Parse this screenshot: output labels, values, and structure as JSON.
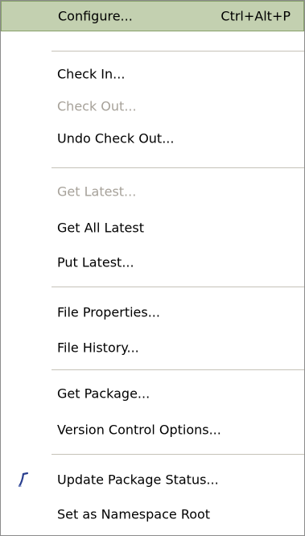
{
  "menu": {
    "items": [
      {
        "label": "Configure...",
        "shortcut": "Ctrl+Alt+P",
        "state": "highlighted"
      },
      {
        "label": "Check In...",
        "state": "enabled"
      },
      {
        "label": "Check Out...",
        "state": "disabled"
      },
      {
        "label": "Undo Check Out...",
        "state": "enabled"
      },
      {
        "label": "Get Latest...",
        "state": "disabled"
      },
      {
        "label": "Get All Latest",
        "state": "enabled"
      },
      {
        "label": "Put Latest...",
        "state": "enabled"
      },
      {
        "label": "File Properties...",
        "state": "enabled"
      },
      {
        "label": "File History...",
        "state": "enabled"
      },
      {
        "label": "Get Package...",
        "state": "enabled"
      },
      {
        "label": "Version Control Options...",
        "state": "enabled"
      },
      {
        "label": "Update Package Status...",
        "state": "enabled",
        "icon": "update-status-icon"
      },
      {
        "label": "Set as Namespace Root",
        "state": "enabled"
      }
    ]
  },
  "colors": {
    "highlight_bg": "#c3d0b0",
    "highlight_border": "#87a06a",
    "disabled_text": "#a6a199",
    "separator": "#c5c2b8",
    "icon_blue": "#2a3f8f"
  }
}
